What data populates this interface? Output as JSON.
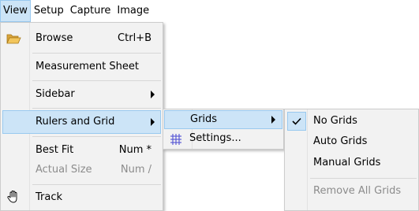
{
  "menubar": {
    "items": [
      {
        "label": "View"
      },
      {
        "label": "Setup"
      },
      {
        "label": "Capture"
      },
      {
        "label": "Image"
      }
    ]
  },
  "view_menu": {
    "items": [
      {
        "label": "Browse",
        "shortcut": "Ctrl+B",
        "icon": "folder-open-icon"
      },
      {
        "label": "Measurement Sheet"
      },
      {
        "label": "Sidebar"
      },
      {
        "label": "Rulers and Grid"
      },
      {
        "label": "Best Fit",
        "shortcut": "Num *"
      },
      {
        "label": "Actual Size",
        "shortcut": "Num /",
        "disabled": true
      },
      {
        "label": "Track",
        "icon": "hand-icon"
      }
    ]
  },
  "rulers_grid_menu": {
    "items": [
      {
        "label": "Grids"
      },
      {
        "label": "Settings...",
        "icon": "grid-icon"
      }
    ]
  },
  "grids_menu": {
    "items": [
      {
        "label": "No Grids",
        "checked": true
      },
      {
        "label": "Auto Grids"
      },
      {
        "label": "Manual Grids"
      },
      {
        "label": "Remove All Grids",
        "disabled": true
      }
    ]
  },
  "colors": {
    "highlight": "#cce4f7",
    "highlight_border": "#99c9ef",
    "menu_bg": "#f2f2f2",
    "disabled_text": "#8c8c8c",
    "folder_icon": "#e8b54a",
    "grid_icon": "#5b5bd6"
  }
}
